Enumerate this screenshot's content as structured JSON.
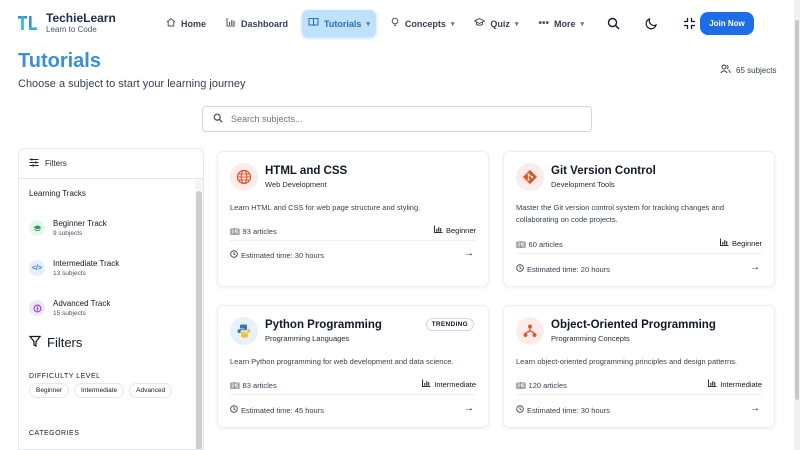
{
  "app": {
    "name": "TechieLearn",
    "tagline": "Learn to Code",
    "logo_mark": "TL"
  },
  "nav": [
    {
      "label": "Home",
      "icon": "home-icon"
    },
    {
      "label": "Dashboard",
      "icon": "chart-icon"
    },
    {
      "label": "Tutorials",
      "icon": "book-icon",
      "active": true
    },
    {
      "label": "Concepts",
      "icon": "lightbulb-icon"
    },
    {
      "label": "Quiz",
      "icon": "graduation-cap-icon"
    },
    {
      "label": "More",
      "icon": "dots-icon"
    }
  ],
  "header_actions": {
    "join_label": "Join Now"
  },
  "page": {
    "title": "Tutorials",
    "subtitle": "Choose a subject to start your learning journey",
    "subjects_count": "65 subjects"
  },
  "search": {
    "placeholder": "Search subjects..."
  },
  "sidebar": {
    "header": "Filters",
    "tracks_label": "Learning Tracks",
    "tracks": [
      {
        "name": "Beginner Track",
        "sub": "9 subjects",
        "color": "#22a05a",
        "bg": "#e6f6ec"
      },
      {
        "name": "Intermediate Track",
        "sub": "13 subjects",
        "color": "#2b7ad8",
        "bg": "#e6f0fb"
      },
      {
        "name": "Advanced Track",
        "sub": "15 subjects",
        "color": "#8b3fd6",
        "bg": "#f1e7fb"
      }
    ],
    "filters_title": "Filters",
    "difficulty_label": "DIFFICULTY LEVEL",
    "difficulty_options": [
      "Beginner",
      "Intermediate",
      "Advanced"
    ],
    "categories_label": "CATEGORIES"
  },
  "cards": [
    {
      "title": "HTML and CSS",
      "category": "Web Development",
      "description": "Learn HTML and CSS for web page structure and styling.",
      "articles": "93 articles",
      "level": "Beginner",
      "time": "Estimated time: 30 hours",
      "badge": "",
      "icon": "globe-icon",
      "icon_color": "#e2572b",
      "icon_bg": "#fdecea"
    },
    {
      "title": "Git Version Control",
      "category": "Development Tools",
      "description": "Master the Git version control system for tracking changes and collaborating on code projects.",
      "articles": "60 articles",
      "level": "Beginner",
      "time": "Estimated time: 20 hours",
      "badge": "",
      "icon": "git-icon",
      "icon_color": "#e2572b",
      "icon_bg": "#fdecea"
    },
    {
      "title": "Python Programming",
      "category": "Programming Languages",
      "description": "Learn Python programming for web development and data science.",
      "articles": "83 articles",
      "level": "Intermediate",
      "time": "Estimated time: 45 hours",
      "badge": "TRENDING",
      "icon": "python-icon",
      "icon_color": "#3776ab",
      "icon_bg": "#e8f0fa"
    },
    {
      "title": "Object-Oriented Programming",
      "category": "Programming Concepts",
      "description": "Learn object-oriented programming principles and design patterns.",
      "articles": "120 articles",
      "level": "Intermediate",
      "time": "Estimated time: 30 hours",
      "badge": "",
      "icon": "hierarchy-icon",
      "icon_color": "#e2572b",
      "icon_bg": "#fdecea"
    }
  ]
}
